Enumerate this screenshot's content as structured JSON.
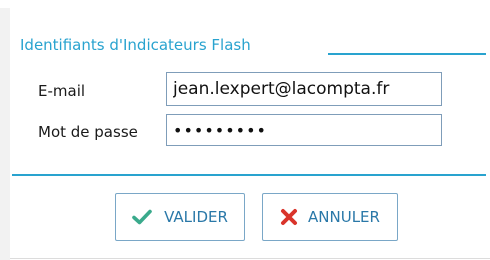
{
  "form": {
    "legend": "Identifiants d'Indicateurs Flash",
    "email_label": "E-mail",
    "email_value": "jean.lexpert@lacompta.fr",
    "password_label": "Mot de passe",
    "password_value": "xxxxxxxxx"
  },
  "actions": {
    "ok_label": "VALIDER",
    "ok_icon": "check-icon",
    "cancel_label": "ANNULER",
    "cancel_icon": "x-icon"
  },
  "colors": {
    "accent": "#29a3cf",
    "ok_icon": "#3aaa8c",
    "cancel_icon": "#d9342b",
    "button_text": "#2a78a8"
  }
}
